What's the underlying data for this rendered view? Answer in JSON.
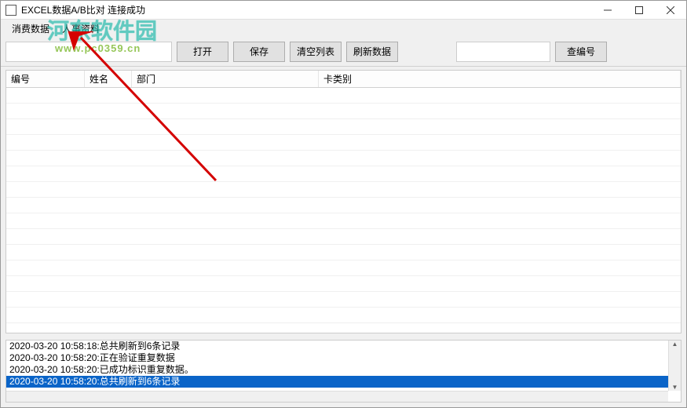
{
  "window": {
    "title": "EXCEL数据A/B比对 连接成功"
  },
  "menu": {
    "item1": "消费数据",
    "item2": "人事资料"
  },
  "toolbar": {
    "open": "打开",
    "save": "保存",
    "clear": "清空列表",
    "refresh": "刷新数据",
    "search_value": "",
    "search_btn": "查编号"
  },
  "grid": {
    "columns": {
      "c1": "编号",
      "c2": "姓名",
      "c3": "部门",
      "c4": "卡类别"
    }
  },
  "log": {
    "lines": [
      "2020-03-20 10:58:18:总共刷新到6条记录",
      "2020-03-20 10:58:20:正在验证重复数据",
      "2020-03-20 10:58:20:已成功标识重复数据。",
      "2020-03-20 10:58:20:总共刷新到6条记录"
    ]
  },
  "watermark": {
    "cn": "河东软件园",
    "en": "www.pc0359.cn"
  }
}
